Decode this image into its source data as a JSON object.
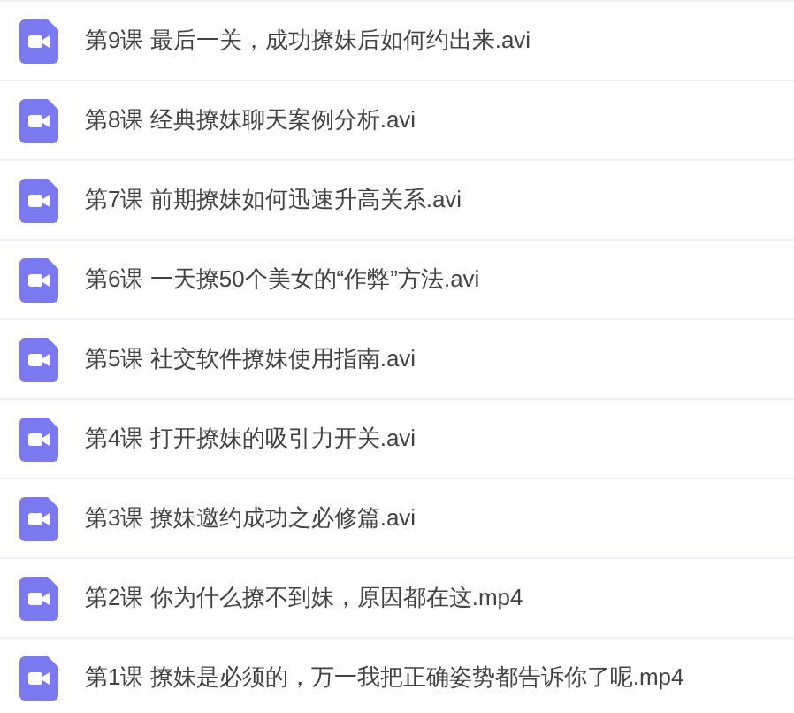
{
  "files": [
    {
      "name": "第9课 最后一关，成功撩妹后如何约出来.avi"
    },
    {
      "name": "第8课 经典撩妹聊天案例分析.avi"
    },
    {
      "name": "第7课 前期撩妹如何迅速升高关系.avi"
    },
    {
      "name": "第6课 一天撩50个美女的“作弊”方法.avi"
    },
    {
      "name": "第5课 社交软件撩妹使用指南.avi"
    },
    {
      "name": "第4课 打开撩妹的吸引力开关.avi"
    },
    {
      "name": "第3课 撩妹邀约成功之必修篇.avi"
    },
    {
      "name": "第2课 你为什么撩不到妹，原因都在这.mp4"
    },
    {
      "name": "第1课 撩妹是必须的，万一我把正确姿势都告诉你了呢.mp4"
    }
  ]
}
